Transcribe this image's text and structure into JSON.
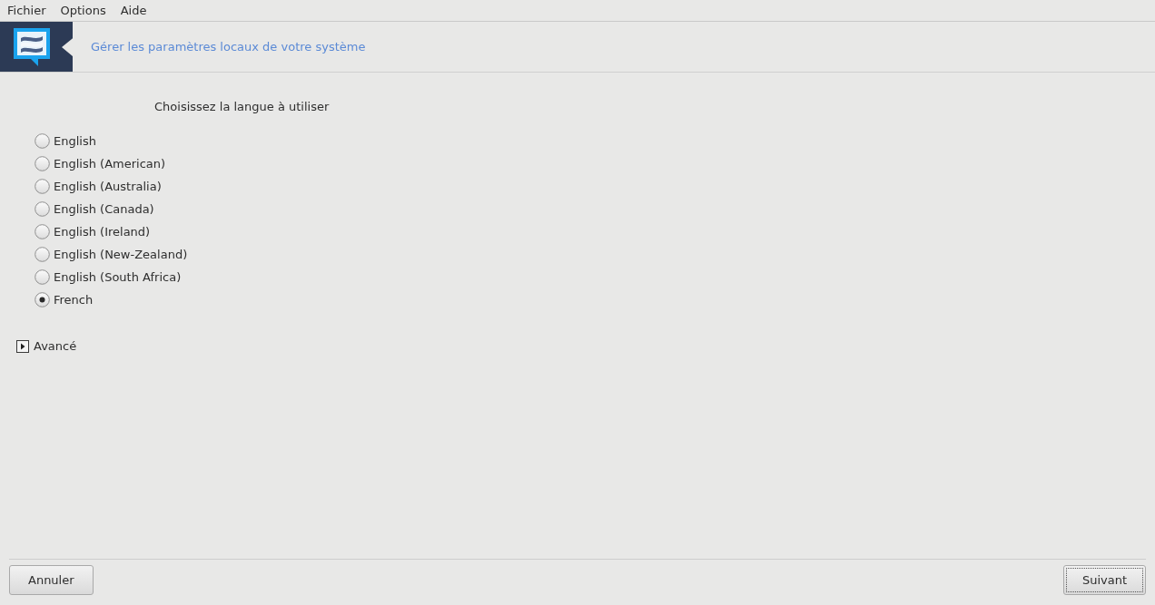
{
  "menu": [
    {
      "label": "Fichier"
    },
    {
      "label": "Options"
    },
    {
      "label": "Aide"
    }
  ],
  "banner": {
    "title": "Gérer les paramètres locaux de votre système"
  },
  "prompt": "Choisissez la langue à utiliser",
  "languages": [
    {
      "label": "English",
      "selected": false
    },
    {
      "label": "English (American)",
      "selected": false
    },
    {
      "label": "English (Australia)",
      "selected": false
    },
    {
      "label": "English (Canada)",
      "selected": false
    },
    {
      "label": "English (Ireland)",
      "selected": false
    },
    {
      "label": "English (New-Zealand)",
      "selected": false
    },
    {
      "label": "English (South Africa)",
      "selected": false
    },
    {
      "label": "French",
      "selected": true
    }
  ],
  "advanced": {
    "label": "Avancé",
    "expanded": false
  },
  "buttons": [
    {
      "label": "Annuler",
      "focused": false
    },
    {
      "label": "Suivant",
      "focused": true
    }
  ]
}
